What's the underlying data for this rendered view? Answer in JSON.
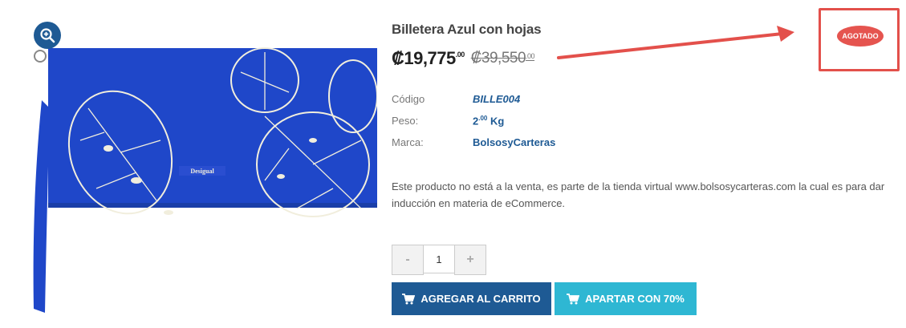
{
  "product": {
    "title": "Billetera Azul con hojas",
    "price_main": "₡19,775",
    "price_decimals": ".00",
    "old_price_main": "₡39,550",
    "old_price_decimals": ".00",
    "specs": [
      {
        "label": "Código",
        "value": "BILLE004"
      },
      {
        "label": "Peso:",
        "value": "2",
        "sup": ".00",
        "unit": " Kg"
      },
      {
        "label": "Marca:",
        "value": "BolsosyCarteras"
      }
    ],
    "description": "Este producto no está a la venta, es parte de la tienda virtual www.bolsosycarteras.com la cual es para dar inducción en materia de eCommerce.",
    "quantity": "1",
    "brand_on_image": "Desigual"
  },
  "stepper": {
    "minus": "-",
    "plus": "+"
  },
  "buttons": {
    "add_to_cart": "AGREGAR AL CARRITO",
    "reserve": "APARTAR CON 70%"
  },
  "badge": {
    "label": "AGOTADO"
  },
  "colors": {
    "primary": "#1e5a94",
    "secondary": "#2eb7d3",
    "badge": "#e5544f",
    "wallet": "#1f47c9"
  },
  "icons": {
    "zoom": "zoom-in-icon",
    "cart": "cart-icon"
  }
}
